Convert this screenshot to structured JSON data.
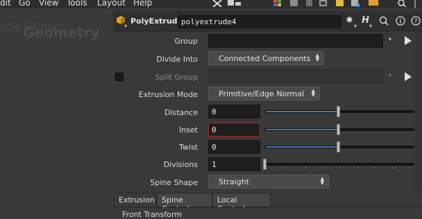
{
  "menubar": {
    "items": [
      "dit",
      "Go",
      "View",
      "Tools",
      "Layout",
      "Help"
    ]
  },
  "left_panel": {
    "ghost_text_1": "ndie Edition",
    "ghost_text_2": "Geometry"
  },
  "header": {
    "node_type": "PolyExtrude",
    "node_name": "polyextrude4"
  },
  "parms": {
    "group": {
      "label": "Group",
      "value": ""
    },
    "divide_into": {
      "label": "Divide Into",
      "value": "Connected Components"
    },
    "split_group": {
      "label": "Split Group",
      "value": ""
    },
    "extrusion_mode": {
      "label": "Extrusion Mode",
      "value": "Primitive/Edge Normal"
    },
    "distance": {
      "label": "Distance",
      "value": "0"
    },
    "inset": {
      "label": "Inset",
      "value": "0"
    },
    "twist": {
      "label": "Twist",
      "value": "0"
    },
    "divisions": {
      "label": "Divisions",
      "value": "1"
    },
    "spine_shape": {
      "label": "Spine Shape",
      "value": "Straight"
    }
  },
  "tabs": [
    "Extrusion",
    "Spine Control",
    "Local Control"
  ],
  "folder": {
    "title": "Front Transform"
  },
  "colors": {
    "accent_blue": "#4a78b0",
    "active_field_border": "#9e2a22",
    "background": "#393939"
  },
  "icons": [
    "gear-icon",
    "help-icon",
    "search-icon",
    "info-icon",
    "question-icon",
    "dropdown-arrow-icon",
    "jump-to-icon"
  ]
}
